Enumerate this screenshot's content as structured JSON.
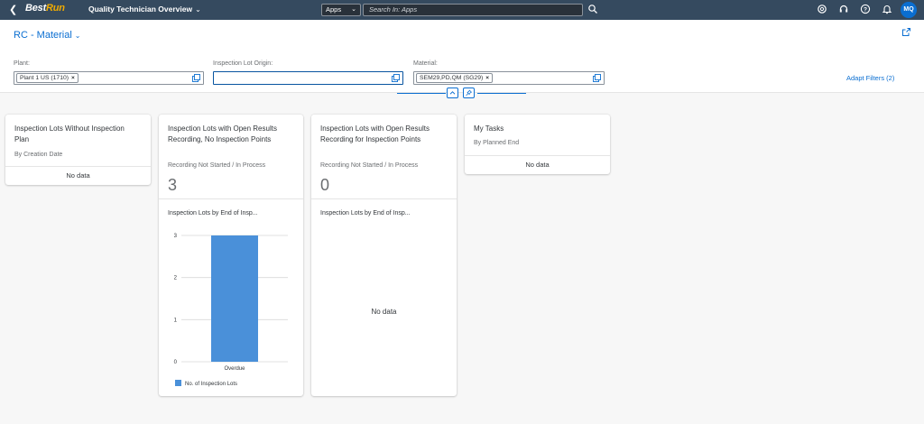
{
  "shell": {
    "logo_best": "Best",
    "logo_run": "Run",
    "app_title": "Quality Technician Overview",
    "scope": "Apps",
    "search_placeholder": "Search In: Apps",
    "avatar_initials": "MQ"
  },
  "header": {
    "variant": "RC - Material",
    "filters": [
      {
        "label": "Plant:",
        "token": "Plant 1 US (1710)"
      },
      {
        "label": "Inspection Lot Origin:",
        "token": ""
      },
      {
        "label": "Material:",
        "token": "SEM29,PD,QM (SG29)"
      }
    ],
    "adapt_filters": "Adapt Filters (2)"
  },
  "cards": [
    {
      "title": "Inspection Lots Without Inspection Plan",
      "subtitle": "By Creation Date",
      "no_data": "No data"
    },
    {
      "title": "Inspection Lots with Open Results Recording, No Inspection Points",
      "subtitle": "Recording Not Started / In Process",
      "kpi": "3",
      "chart_title": "Inspection Lots by End of Insp..."
    },
    {
      "title": "Inspection Lots with Open Results Recording for Inspection Points",
      "subtitle": "Recording Not Started / In Process",
      "kpi": "0",
      "chart_title": "Inspection Lots by End of Insp...",
      "no_data": "No data"
    },
    {
      "title": "My Tasks",
      "subtitle": "By Planned End",
      "no_data": "No data"
    }
  ],
  "chart_data": {
    "type": "bar",
    "categories": [
      "Overdue"
    ],
    "series": [
      {
        "name": "No. of Inspection Lots",
        "values": [
          3
        ]
      }
    ],
    "yticks": [
      "0",
      "1",
      "2",
      "3"
    ],
    "ylim": [
      0,
      3
    ],
    "color": "#4a90d9"
  },
  "colors": {
    "shell": "#354a5f",
    "accent": "#0a6ed1",
    "bar": "#4a90d9"
  },
  "icons": [
    "back-icon",
    "chevron-down-icon",
    "search-icon",
    "notifications-icon",
    "help-icon",
    "headset-icon",
    "copilot-icon",
    "share-icon",
    "value-help-icon",
    "collapse-header-icon",
    "pin-icon"
  ]
}
